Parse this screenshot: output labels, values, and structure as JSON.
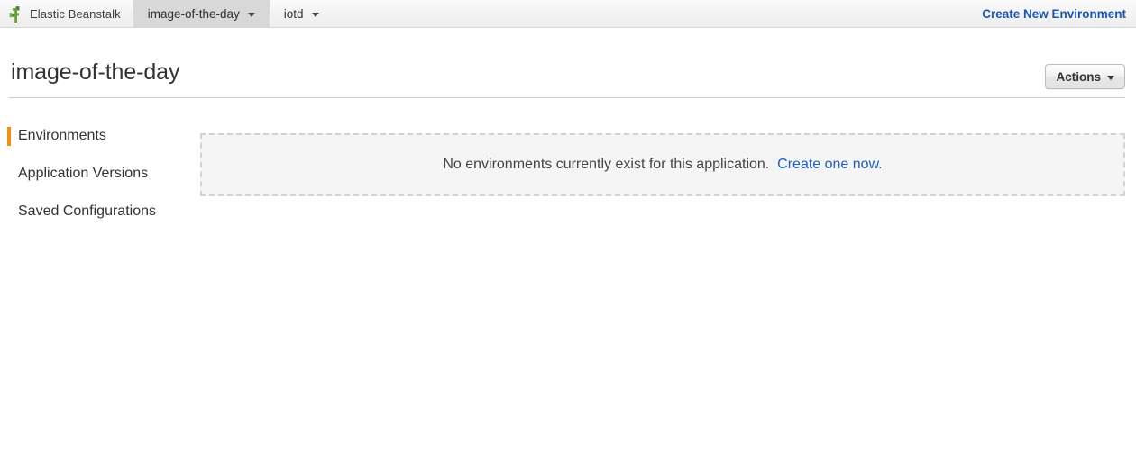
{
  "topbar": {
    "brand": {
      "logo_icon": "beanstalk-sprout-icon",
      "label": "Elastic Beanstalk"
    },
    "tabs": [
      {
        "label": "image-of-the-day",
        "active": true,
        "caret_icon": "chevron-down-icon"
      },
      {
        "label": "iotd",
        "active": false,
        "caret_icon": "chevron-down-icon"
      }
    ],
    "action_link": "Create New Environment",
    "action_link_color": "#1b55b5"
  },
  "page": {
    "title": "image-of-the-day",
    "actions_button": {
      "label": "Actions",
      "caret_icon": "chevron-down-icon"
    }
  },
  "sidebar": {
    "items": [
      {
        "label": "Environments",
        "active": true
      },
      {
        "label": "Application Versions",
        "active": false
      },
      {
        "label": "Saved Configurations",
        "active": false
      }
    ],
    "active_indicator_color": "#f29111"
  },
  "main": {
    "empty_state": {
      "message": "No environments currently exist for this application.",
      "link_label": "Create one now.",
      "link_color": "#1c5fc4",
      "background": "#f5f5f5",
      "border_color": "#d3d3d3"
    }
  }
}
